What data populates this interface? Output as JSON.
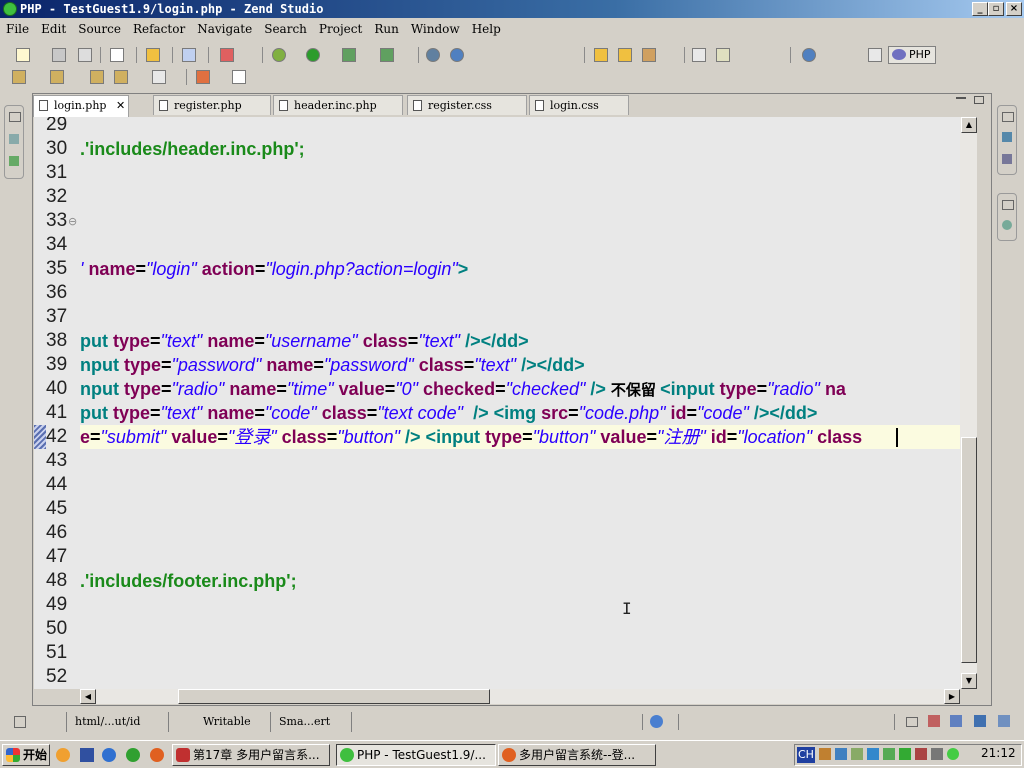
{
  "window": {
    "title": "PHP - TestGuest1.9/login.php - Zend Studio"
  },
  "menu": [
    "File",
    "Edit",
    "Source",
    "Refactor",
    "Navigate",
    "Search",
    "Project",
    "Run",
    "Window",
    "Help"
  ],
  "perspective": {
    "label": "PHP"
  },
  "tabs": [
    {
      "label": "login.php",
      "active": true
    },
    {
      "label": "register.php",
      "active": false
    },
    {
      "label": "header.inc.php",
      "active": false
    },
    {
      "label": "register.css",
      "active": false
    },
    {
      "label": "login.css",
      "active": false
    }
  ],
  "editor": {
    "line_numbers": [
      "29",
      "30",
      "31",
      "32",
      "33",
      "34",
      "35",
      "36",
      "37",
      "38",
      "39",
      "40",
      "41",
      "42",
      "43",
      "44",
      "45",
      "46",
      "47",
      "48",
      "49",
      "50",
      "51",
      "52"
    ],
    "current_line": "42",
    "lines": {
      "l30": [
        {
          "c": "p",
          "t": ".'includes/header.inc.php';"
        }
      ],
      "l35": [
        {
          "c": "s",
          "t": "' "
        },
        {
          "c": "k",
          "t": "name"
        },
        {
          "c": "",
          "t": "="
        },
        {
          "c": "s",
          "t": "\"login\" "
        },
        {
          "c": "k",
          "t": "action"
        },
        {
          "c": "",
          "t": "="
        },
        {
          "c": "s",
          "t": "\"login.php?action=login\""
        },
        {
          "c": "t",
          "t": ">"
        }
      ],
      "l38": [
        {
          "c": "t",
          "t": "put "
        },
        {
          "c": "k",
          "t": "type"
        },
        {
          "c": "",
          "t": "="
        },
        {
          "c": "s",
          "t": "\"text\" "
        },
        {
          "c": "k",
          "t": "name"
        },
        {
          "c": "",
          "t": "="
        },
        {
          "c": "s",
          "t": "\"username\" "
        },
        {
          "c": "k",
          "t": "class"
        },
        {
          "c": "",
          "t": "="
        },
        {
          "c": "s",
          "t": "\"text\" "
        },
        {
          "c": "t",
          "t": "/></dd>"
        }
      ],
      "l39": [
        {
          "c": "t",
          "t": "nput "
        },
        {
          "c": "k",
          "t": "type"
        },
        {
          "c": "",
          "t": "="
        },
        {
          "c": "s",
          "t": "\"password\" "
        },
        {
          "c": "k",
          "t": "name"
        },
        {
          "c": "",
          "t": "="
        },
        {
          "c": "s",
          "t": "\"password\" "
        },
        {
          "c": "k",
          "t": "class"
        },
        {
          "c": "",
          "t": "="
        },
        {
          "c": "s",
          "t": "\"text\" "
        },
        {
          "c": "t",
          "t": "/></dd>"
        }
      ],
      "l40": [
        {
          "c": "t",
          "t": "nput "
        },
        {
          "c": "k",
          "t": "type"
        },
        {
          "c": "",
          "t": "="
        },
        {
          "c": "s",
          "t": "\"radio\" "
        },
        {
          "c": "k",
          "t": "name"
        },
        {
          "c": "",
          "t": "="
        },
        {
          "c": "s",
          "t": "\"time\" "
        },
        {
          "c": "k",
          "t": "value"
        },
        {
          "c": "",
          "t": "="
        },
        {
          "c": "s",
          "t": "\"0\" "
        },
        {
          "c": "k",
          "t": "checked"
        },
        {
          "c": "",
          "t": "="
        },
        {
          "c": "s",
          "t": "\"checked\" "
        },
        {
          "c": "t",
          "t": "/> "
        },
        {
          "c": "zh",
          "t": "不保留 "
        },
        {
          "c": "t",
          "t": "<input "
        },
        {
          "c": "k",
          "t": "type"
        },
        {
          "c": "",
          "t": "="
        },
        {
          "c": "s",
          "t": "\"radio\" "
        },
        {
          "c": "k",
          "t": "na"
        }
      ],
      "l41": [
        {
          "c": "t",
          "t": "put "
        },
        {
          "c": "k",
          "t": "type"
        },
        {
          "c": "",
          "t": "="
        },
        {
          "c": "s",
          "t": "\"text\" "
        },
        {
          "c": "k",
          "t": "name"
        },
        {
          "c": "",
          "t": "="
        },
        {
          "c": "s",
          "t": "\"code\" "
        },
        {
          "c": "k",
          "t": "class"
        },
        {
          "c": "",
          "t": "="
        },
        {
          "c": "s",
          "t": "\"text code\"  "
        },
        {
          "c": "t",
          "t": "/> <img "
        },
        {
          "c": "k",
          "t": "src"
        },
        {
          "c": "",
          "t": "="
        },
        {
          "c": "s",
          "t": "\"code.php\" "
        },
        {
          "c": "k",
          "t": "id"
        },
        {
          "c": "",
          "t": "="
        },
        {
          "c": "s",
          "t": "\"code\" "
        },
        {
          "c": "t",
          "t": "/></dd>"
        }
      ],
      "l42": [
        {
          "c": "k",
          "t": "e"
        },
        {
          "c": "",
          "t": "="
        },
        {
          "c": "s",
          "t": "\"submit\" "
        },
        {
          "c": "k",
          "t": "value"
        },
        {
          "c": "",
          "t": "="
        },
        {
          "c": "s",
          "t": "\"登录\" "
        },
        {
          "c": "k",
          "t": "class"
        },
        {
          "c": "",
          "t": "="
        },
        {
          "c": "s",
          "t": "\"button\" "
        },
        {
          "c": "t",
          "t": "/> <input "
        },
        {
          "c": "k",
          "t": "type"
        },
        {
          "c": "",
          "t": "="
        },
        {
          "c": "s",
          "t": "\"button\" "
        },
        {
          "c": "k",
          "t": "value"
        },
        {
          "c": "",
          "t": "="
        },
        {
          "c": "s",
          "t": "\"注册\" "
        },
        {
          "c": "k",
          "t": "id"
        },
        {
          "c": "",
          "t": "="
        },
        {
          "c": "s",
          "t": "\"location\" "
        },
        {
          "c": "k",
          "t": "class"
        }
      ],
      "l48": [
        {
          "c": "p",
          "t": ".'includes/footer.inc.php';"
        }
      ]
    }
  },
  "statusbar": {
    "path": "html/...ut/id",
    "mode": "Writable",
    "insert": "Sma...ert"
  },
  "taskbar": {
    "start": "开始",
    "tasks": [
      {
        "label": "第17章 多用户留言系...",
        "pressed": false
      },
      {
        "label": "PHP - TestGuest1.9/...",
        "pressed": true
      },
      {
        "label": "多用户留言系统--登...",
        "pressed": false
      }
    ],
    "lang": "CH",
    "clock": "21:12"
  }
}
